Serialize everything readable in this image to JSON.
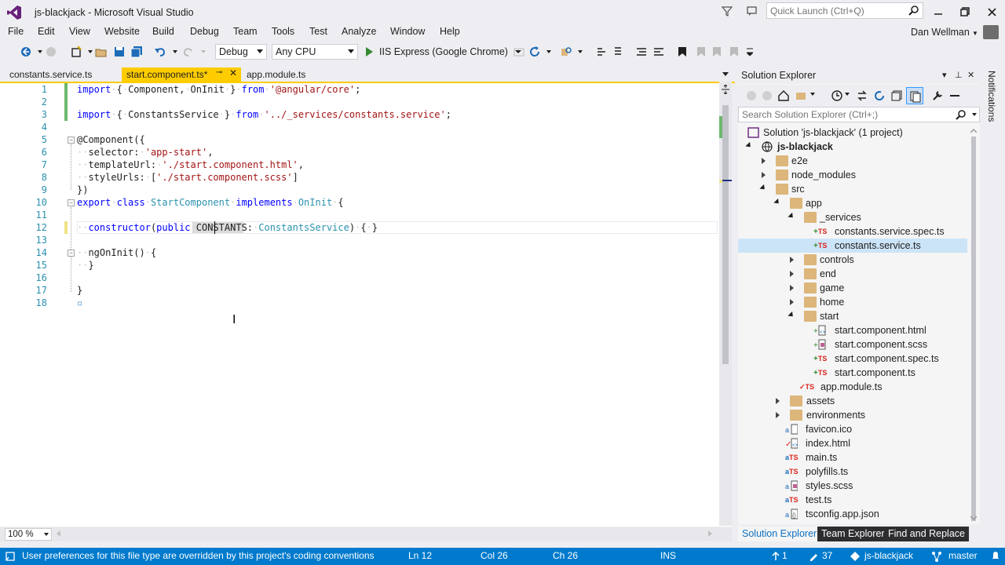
{
  "window": {
    "title": "js-blackjack - Microsoft Visual Studio",
    "quick_launch_placeholder": "Quick Launch (Ctrl+Q)"
  },
  "menu": [
    "File",
    "Edit",
    "View",
    "Website",
    "Build",
    "Debug",
    "Team",
    "Tools",
    "Test",
    "Analyze",
    "Window",
    "Help"
  ],
  "user": {
    "name": "Dan Wellman"
  },
  "toolbar": {
    "config": "Debug",
    "platform": "Any CPU",
    "run_target": "IIS Express (Google Chrome)"
  },
  "tabs": [
    {
      "label": "constants.service.ts",
      "active": false
    },
    {
      "label": "start.component.ts*",
      "active": true
    },
    {
      "label": "app.module.ts",
      "active": false
    }
  ],
  "editor": {
    "lines": [
      "1",
      "2",
      "3",
      "4",
      "5",
      "6",
      "7",
      "8",
      "9",
      "10",
      "11",
      "12",
      "13",
      "14",
      "15",
      "16",
      "17",
      "18"
    ],
    "zoom": "100 %"
  },
  "solution_explorer": {
    "title": "Solution Explorer",
    "search_placeholder": "Search Solution Explorer (Ctrl+;)",
    "nodes": [
      {
        "label": "Solution 'js-blackjack' (1 project)"
      },
      {
        "label": "js-blackjack"
      },
      {
        "label": "e2e"
      },
      {
        "label": "node_modules"
      },
      {
        "label": "src"
      },
      {
        "label": "app"
      },
      {
        "label": "_services"
      },
      {
        "label": "constants.service.spec.ts"
      },
      {
        "label": "constants.service.ts"
      },
      {
        "label": "controls"
      },
      {
        "label": "end"
      },
      {
        "label": "game"
      },
      {
        "label": "home"
      },
      {
        "label": "start"
      },
      {
        "label": "start.component.html"
      },
      {
        "label": "start.component.scss"
      },
      {
        "label": "start.component.spec.ts"
      },
      {
        "label": "start.component.ts"
      },
      {
        "label": "app.module.ts"
      },
      {
        "label": "assets"
      },
      {
        "label": "environments"
      },
      {
        "label": "favicon.ico"
      },
      {
        "label": "index.html"
      },
      {
        "label": "main.ts"
      },
      {
        "label": "polyfills.ts"
      },
      {
        "label": "styles.scss"
      },
      {
        "label": "test.ts"
      },
      {
        "label": "tsconfig.app.json"
      }
    ],
    "bottom_tabs": [
      "Solution Explorer",
      "Team Explorer",
      "Find and Replace"
    ]
  },
  "notifications": {
    "label": "Notifications"
  },
  "status": {
    "message": "User preferences for this file type are overridden by this project's coding conventions",
    "ln": "Ln 12",
    "col": "Col 26",
    "ch": "Ch 26",
    "mode": "INS",
    "up_count": "1",
    "changes": "37",
    "repo": "js-blackjack",
    "branch": "master"
  }
}
